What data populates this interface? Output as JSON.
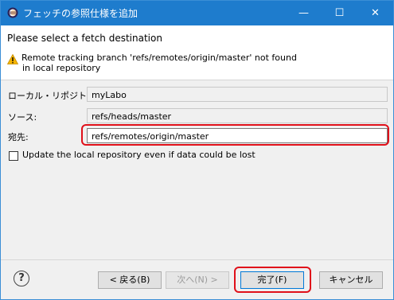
{
  "window": {
    "title": "フェッチの参照仕様を追加",
    "minimize_glyph": "—",
    "maximize_glyph": "☐",
    "close_glyph": "✕"
  },
  "header": {
    "title": "Please select a fetch destination",
    "warning_line1": "Remote tracking branch 'refs/remotes/origin/master' not found",
    "warning_line2": "in local repository"
  },
  "form": {
    "repo_label": "ローカル・リポジトリー:",
    "repo_value": "myLabo",
    "source_label": "ソース:",
    "source_value": "refs/heads/master",
    "dest_label": "宛先:",
    "dest_value": "refs/remotes/origin/master",
    "update_label": "Update the local repository even if data could be lost",
    "update_checked": false
  },
  "footer": {
    "help_glyph": "?",
    "back": "< 戻る(B)",
    "next": "次へ(N) >",
    "finish": "完了(F)",
    "cancel": "キャンセル"
  },
  "icons": {
    "app": "eclipse-icon",
    "warning": "warning-icon",
    "help": "help-icon"
  },
  "colors": {
    "titlebar": "#1e7ccd",
    "highlight": "#e0101a",
    "warning": "#f5b400"
  }
}
